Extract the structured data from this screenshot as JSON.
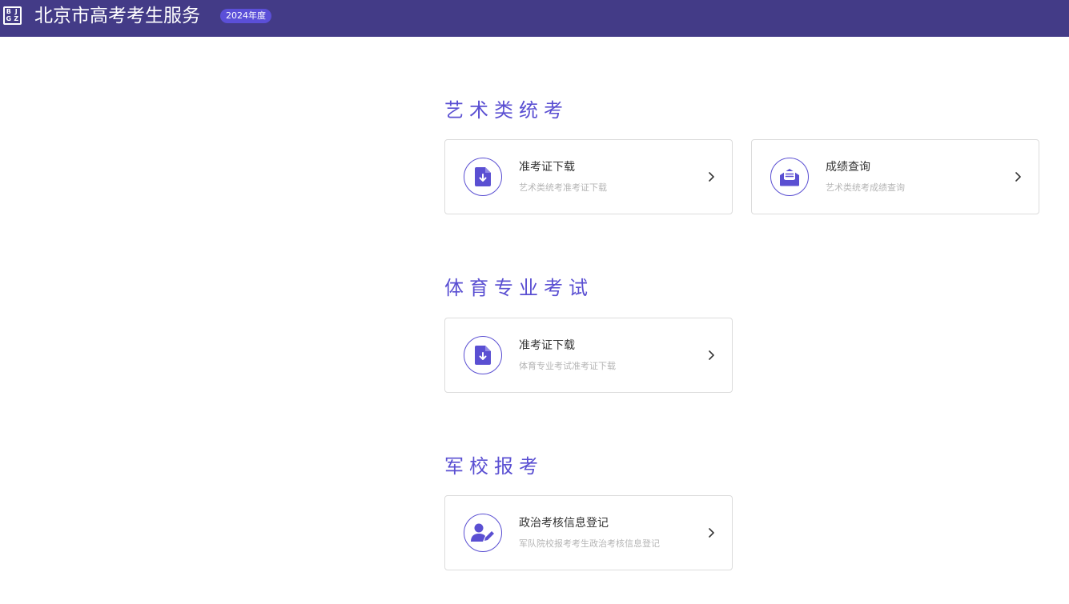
{
  "header": {
    "logo_letters": [
      "B",
      "J",
      "G",
      "Z"
    ],
    "title": "北京市高考考生服务",
    "year_badge": "2024年度"
  },
  "sections": [
    {
      "title": "艺术类统考",
      "cards": [
        {
          "title": "准考证下载",
          "subtitle": "艺术类统考准考证下载",
          "icon": "file-download-icon"
        },
        {
          "title": "成绩查询",
          "subtitle": "艺术类统考成绩查询",
          "icon": "envelope-open-icon"
        }
      ]
    },
    {
      "title": "体育专业考试",
      "cards": [
        {
          "title": "准考证下载",
          "subtitle": "体育专业考试准考证下载",
          "icon": "file-download-icon"
        }
      ]
    },
    {
      "title": "军校报考",
      "cards": [
        {
          "title": "政治考核信息登记",
          "subtitle": "军队院校报考考生政治考核信息登记",
          "icon": "user-edit-icon"
        }
      ]
    }
  ],
  "colors": {
    "header_bg": "#433b87",
    "accent": "#5a4fd2",
    "badge_bg": "#5b4fd8",
    "card_border": "#dcdcdc",
    "subtitle_text": "#b5b5b5"
  }
}
